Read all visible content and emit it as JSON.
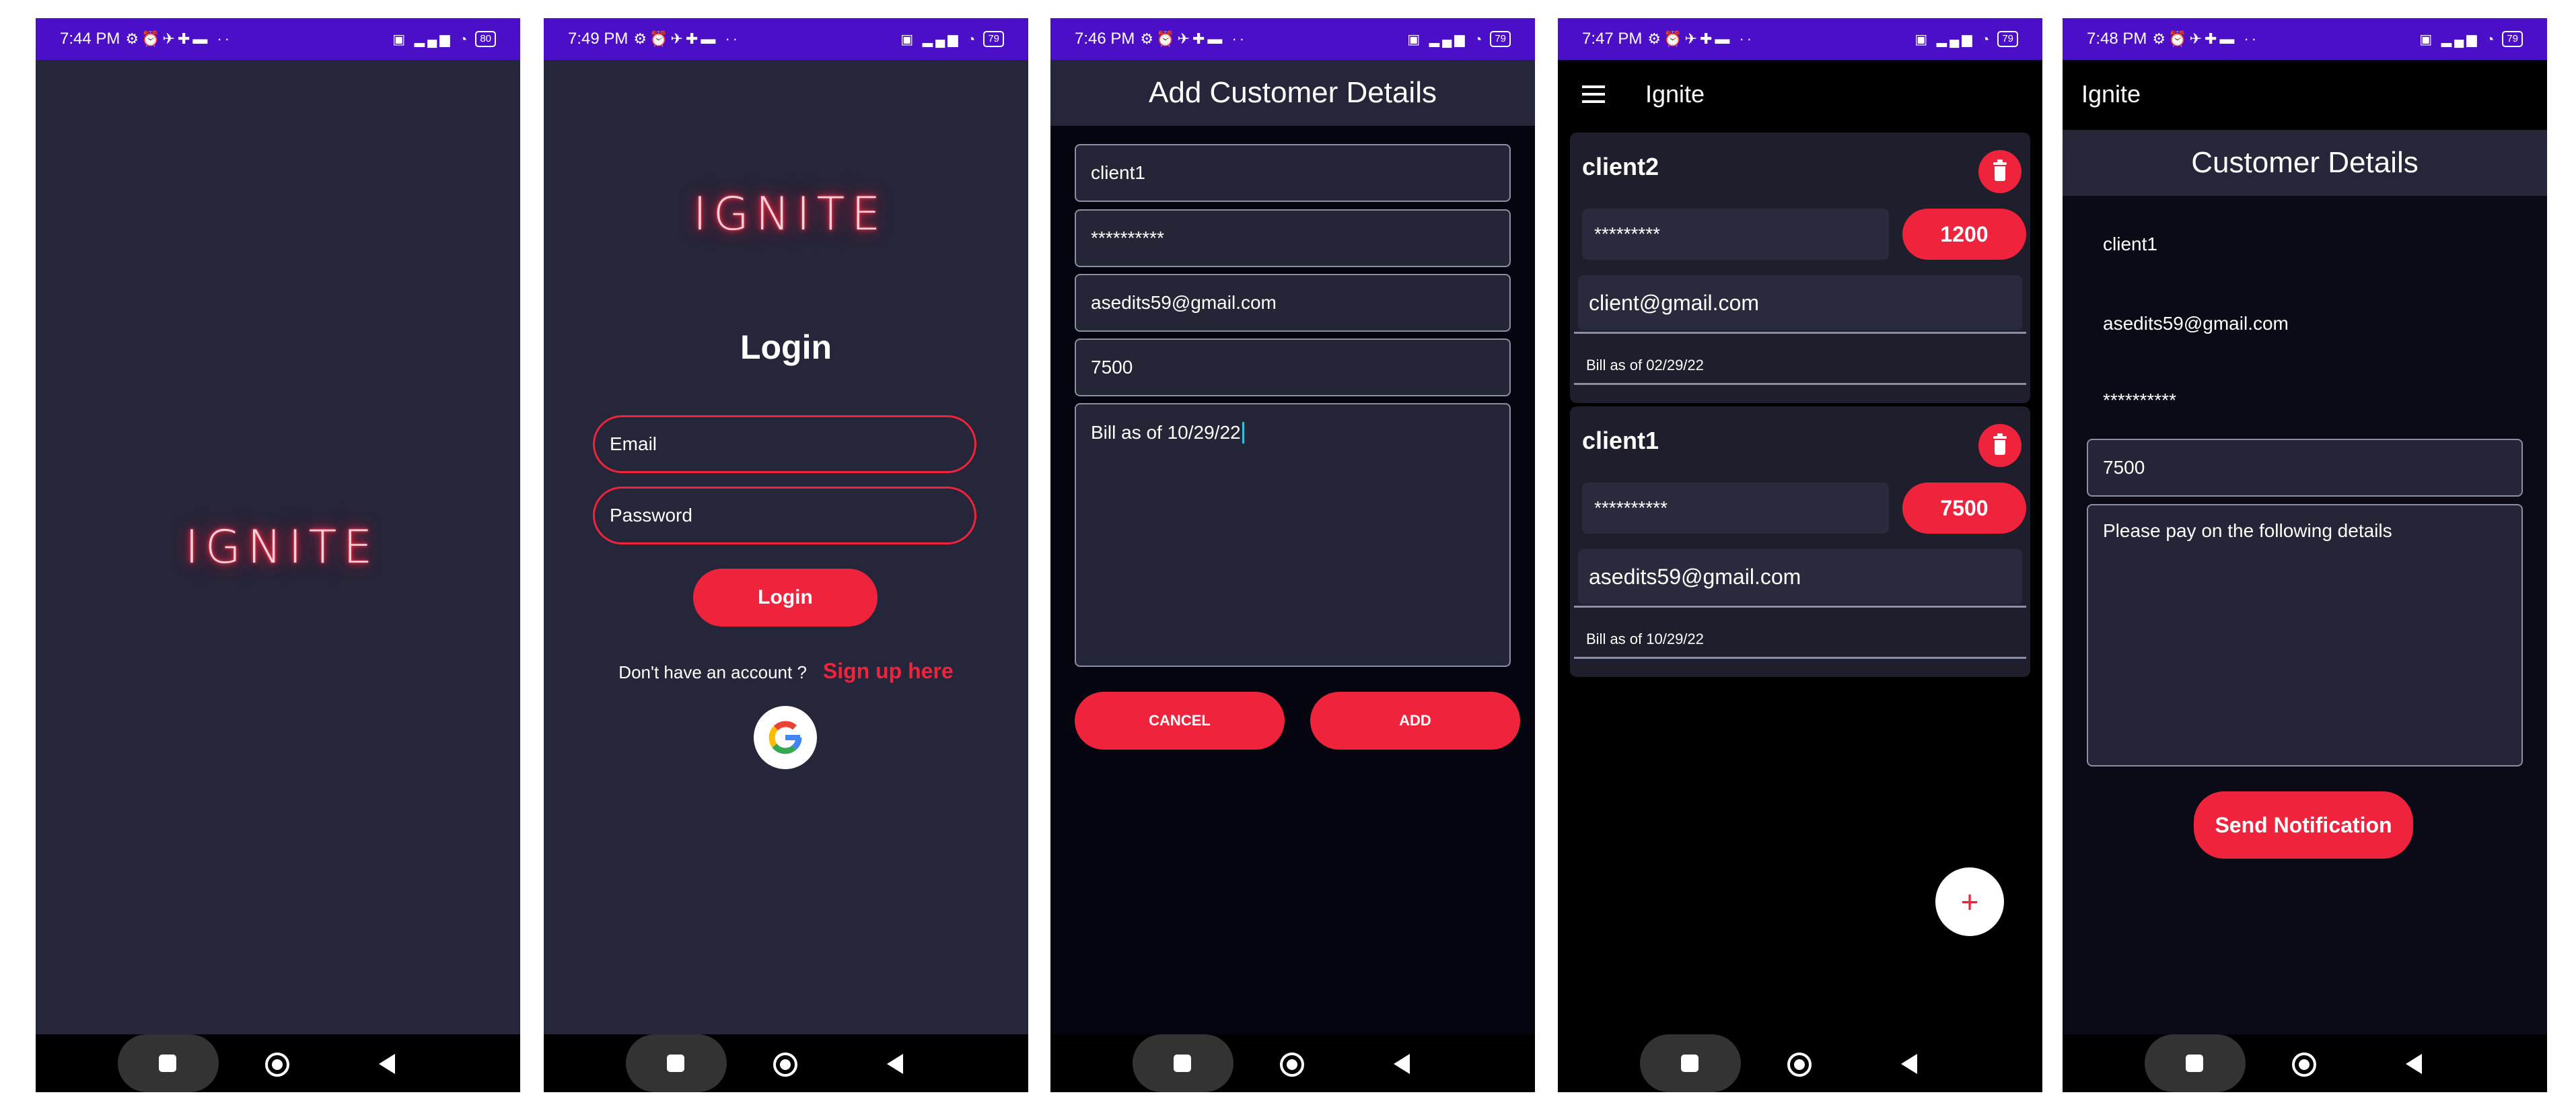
{
  "status_times": [
    "7:44 PM",
    "7:49 PM",
    "7:46 PM",
    "7:47 PM",
    "7:48 PM"
  ],
  "battery": [
    "80",
    "79",
    "79",
    "79",
    "79"
  ],
  "logo_text": "IGNITE",
  "colors": {
    "status_bar": "#4c0fc8",
    "accent": "#ef233c",
    "screen_bg": "#26263a",
    "dark_bg": "#000000"
  },
  "login": {
    "title": "Login",
    "email_placeholder": "Email",
    "password_placeholder": "Password",
    "login_button": "Login",
    "no_account_text": "Don't have an account ?",
    "signup_link": "Sign up here",
    "google_icon": "google-g-logo"
  },
  "add_customer": {
    "title": "Add Customer Details",
    "name": "client1",
    "password": "**********",
    "email": "asedits59@gmail.com",
    "amount": "7500",
    "note": "Bill as of 10/29/22",
    "cancel_button": "CANCEL",
    "add_button": "ADD"
  },
  "customer_list": {
    "app_title": "Ignite",
    "menu_icon": "hamburger-menu-icon",
    "customers": [
      {
        "name": "client2",
        "password": "*********",
        "amount": "1200",
        "email": "client@gmail.com",
        "note": "Bill as of 02/29/22"
      },
      {
        "name": "client1",
        "password": "**********",
        "amount": "7500",
        "email": "asedits59@gmail.com",
        "note": "Bill as of 10/29/22"
      }
    ],
    "fab_label": "+"
  },
  "customer_details": {
    "app_title": "Ignite",
    "header": "Customer Details",
    "name": "client1",
    "email": "asedits59@gmail.com",
    "password": "**********",
    "amount": "7500",
    "message": "Please pay on the following details",
    "send_button": "Send Notification"
  }
}
